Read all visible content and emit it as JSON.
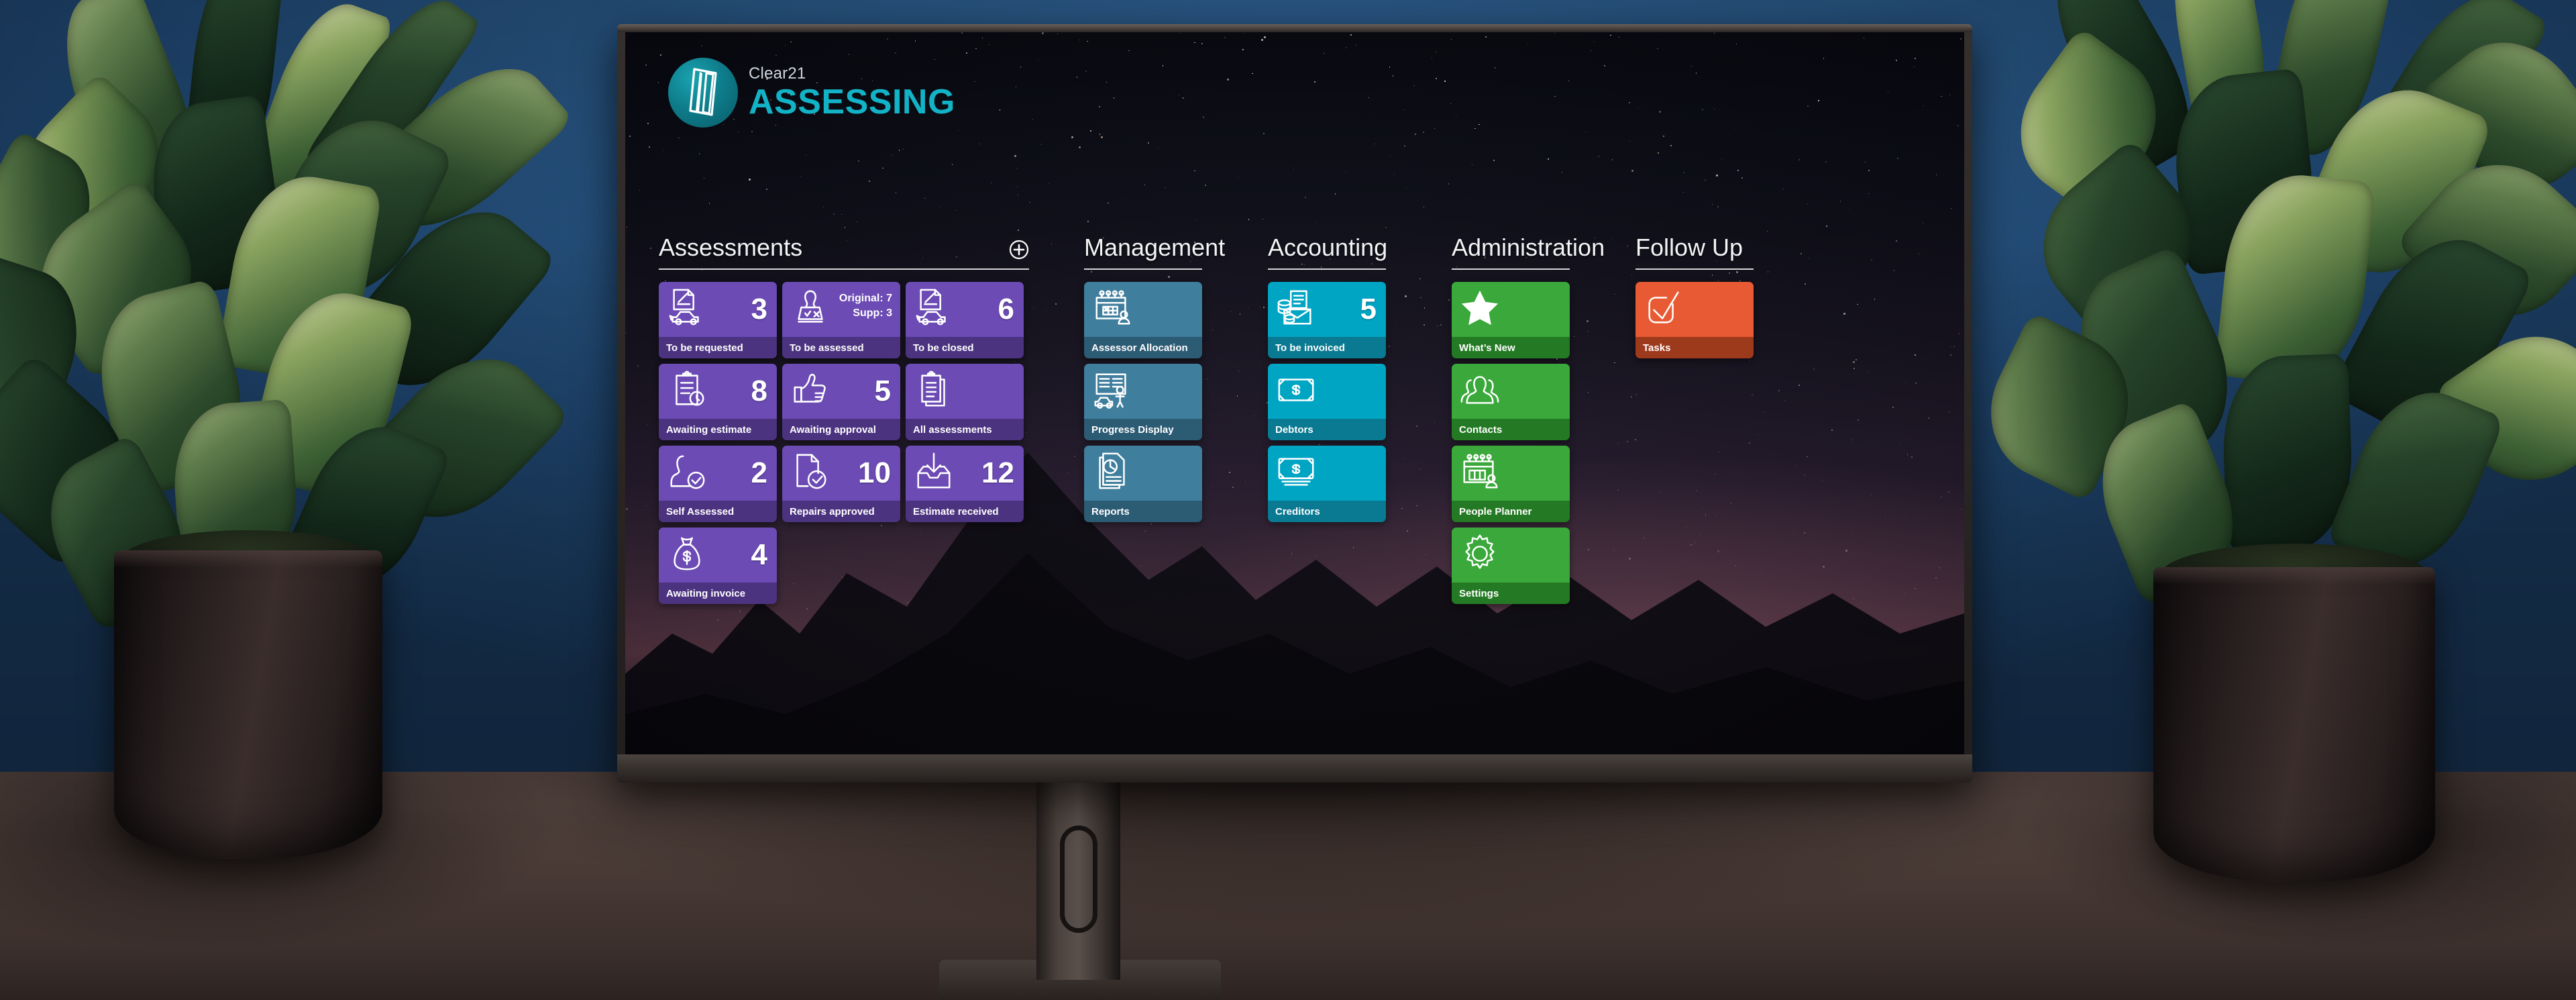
{
  "brand": {
    "sub": "Clear21",
    "main": "ASSESSING",
    "logo_icon": "clear21-logo-mark",
    "circle_color": "#0e7d8b",
    "main_color": "#13b3c7"
  },
  "columns": [
    {
      "id": "assessments",
      "title": "Assessments",
      "has_add_button": true,
      "add_icon": "circle-plus-icon",
      "palette": "p-purple",
      "accent": "#6c4bb5",
      "tiles": [
        {
          "label": "To be requested",
          "count": "3",
          "icon": "car-estimate-icon"
        },
        {
          "label": "To be assessed",
          "count": "",
          "icon": "assessor-approve-reject-icon",
          "sub": [
            "Original: 7",
            "Supp: 3"
          ]
        },
        {
          "label": "To be closed",
          "count": "6",
          "icon": "car-estimate-icon"
        },
        {
          "label": "Awaiting estimate",
          "count": "8",
          "icon": "clipboard-clock-icon"
        },
        {
          "label": "Awaiting approval",
          "count": "5",
          "icon": "thumbs-up-icon"
        },
        {
          "label": "All assessments",
          "count": "",
          "icon": "clipboard-stack-icon"
        },
        {
          "label": "Self Assessed",
          "count": "2",
          "icon": "person-check-icon"
        },
        {
          "label": "Repairs approved",
          "count": "10",
          "icon": "document-check-icon"
        },
        {
          "label": "Estimate received",
          "count": "12",
          "icon": "inbox-download-icon"
        },
        {
          "label": "Awaiting invoice",
          "count": "4",
          "icon": "money-bag-icon"
        }
      ]
    },
    {
      "id": "management",
      "title": "Management",
      "has_add_button": false,
      "palette": "p-steel",
      "accent": "#3f7e9d",
      "tiles": [
        {
          "label": "Assessor Allocation",
          "count": "",
          "icon": "calendar-person-icon"
        },
        {
          "label": "Progress Display",
          "count": "",
          "icon": "board-person-car-icon"
        },
        {
          "label": "Reports",
          "count": "",
          "icon": "report-piechart-icon"
        }
      ]
    },
    {
      "id": "accounting",
      "title": "Accounting",
      "has_add_button": false,
      "palette": "p-cyan",
      "accent": "#00a5c4",
      "tiles": [
        {
          "label": "To be invoiced",
          "count": "5",
          "icon": "invoice-coins-icon"
        },
        {
          "label": "Debtors",
          "count": "",
          "icon": "banknote-icon"
        },
        {
          "label": "Creditors",
          "count": "",
          "icon": "banknote-stack-icon"
        }
      ]
    },
    {
      "id": "administration",
      "title": "Administration",
      "has_add_button": false,
      "palette": "p-green",
      "accent": "#3aa83a",
      "tiles": [
        {
          "label": "What’s New",
          "count": "",
          "icon": "star-icon"
        },
        {
          "label": "Contacts",
          "count": "",
          "icon": "people-group-icon"
        },
        {
          "label": "People Planner",
          "count": "",
          "icon": "calendar-planner-icon"
        },
        {
          "label": "Settings",
          "count": "",
          "icon": "gear-icon"
        }
      ]
    },
    {
      "id": "follow-up",
      "title": "Follow Up",
      "has_add_button": false,
      "palette": "p-orange",
      "accent": "#e85a33",
      "tiles": [
        {
          "label": "Tasks",
          "count": "",
          "icon": "checkbox-tick-icon"
        }
      ]
    }
  ],
  "scene": {
    "wall_color": "#27537f",
    "desk_color": "#4a3b36",
    "wallpaper": "starry-night-mountains"
  }
}
